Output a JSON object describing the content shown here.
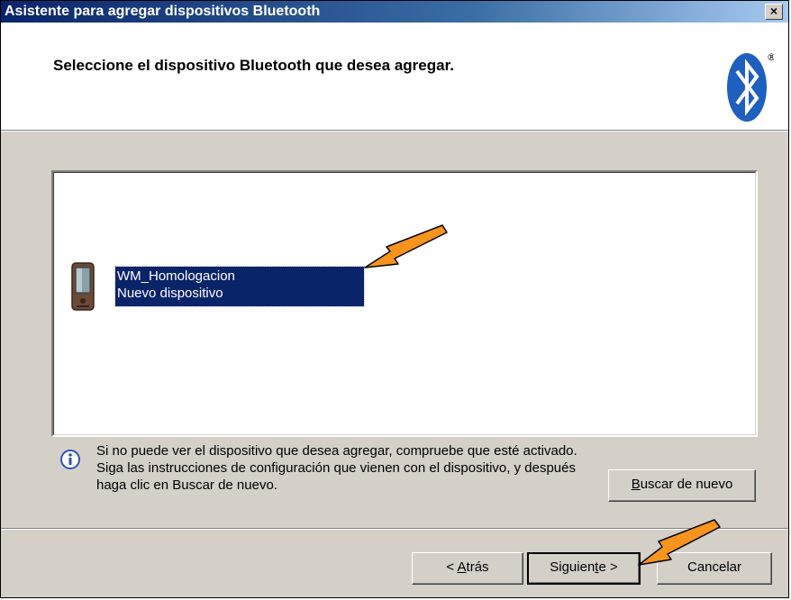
{
  "window": {
    "title": "Asistente para agregar dispositivos Bluetooth",
    "close_label": "×"
  },
  "header": {
    "title": "Seleccione el dispositivo Bluetooth que desea agregar."
  },
  "device_list": {
    "items": [
      {
        "name": "WM_Homologacion",
        "status": "Nuevo dispositivo",
        "icon": "pda-device-icon",
        "selected": true
      }
    ]
  },
  "info": {
    "text": "Si no puede ver el dispositivo que desea agregar, compruebe que esté activado. Siga las instrucciones de configuración que vienen con el dispositivo, y después haga clic en Buscar de nuevo."
  },
  "buttons": {
    "search_again": "Buscar de nuevo",
    "back": "< Atrás",
    "next": "Siguiente >",
    "cancel": "Cancelar"
  },
  "colors": {
    "selection": "#0a246a",
    "arrow": "#f7941d",
    "bluetooth": "#1f5fbf"
  }
}
